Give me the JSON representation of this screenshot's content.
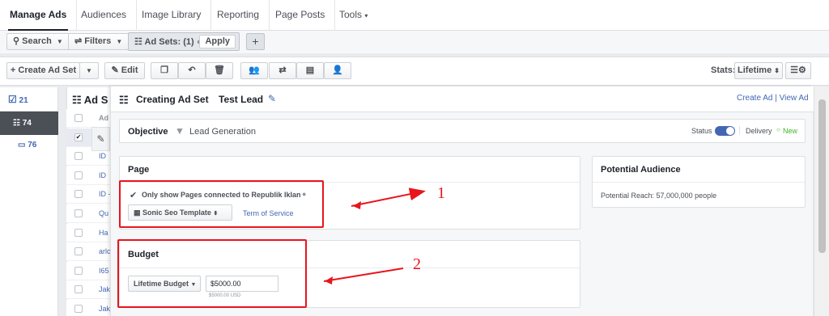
{
  "nav": {
    "tabs": [
      "Manage Ads",
      "Audiences",
      "Image Library",
      "Reporting",
      "Page Posts",
      "Tools"
    ],
    "tools_caret": "▾"
  },
  "filterbar": {
    "search_label": "Search",
    "filters_label": "Filters",
    "adsets_label": "Ad Sets: (1)",
    "apply_label": "Apply",
    "plus_label": "+"
  },
  "toolbar": {
    "create_label": "Create Ad Set",
    "edit_label": "Edit",
    "stats_label": "Stats:",
    "lifetime_label": "Lifetime"
  },
  "rail": {
    "campaigns_count": "21",
    "adsets_count": "74",
    "ads_count": "76"
  },
  "bgtable": {
    "header_letter": "Ad",
    "title_fragment": "Ad S",
    "rows": [
      "Ad",
      "",
      "ID",
      "ID",
      "ID -",
      "Qu",
      "Ha",
      "arlc",
      "I65",
      "Jak",
      "Jak"
    ]
  },
  "panel": {
    "title": "Creating Ad Set",
    "adset_name": "Test Lead",
    "create_ad_link": "Create Ad",
    "separator": "|",
    "view_ad_link": "View Ad",
    "objective_label": "Objective",
    "objective_value": "Lead Generation",
    "status_label": "Status",
    "delivery_label": "Delivery",
    "delivery_value": "New",
    "page_title": "Page",
    "page_checkbox_label": "Only show Pages connected to Republik Iklan",
    "page_select": "Sonic Seo Template",
    "term_link": "Term of Service",
    "audience_title": "Potential Audience",
    "audience_reach": "Potential Reach: 57,000,000 people",
    "budget_title": "Budget",
    "budget_type": "Lifetime Budget",
    "budget_value": "$5000.00",
    "budget_note": "$5000.00 USD"
  },
  "annotations": {
    "label_1": "1",
    "label_2": "2",
    "color": "#e8151d"
  }
}
